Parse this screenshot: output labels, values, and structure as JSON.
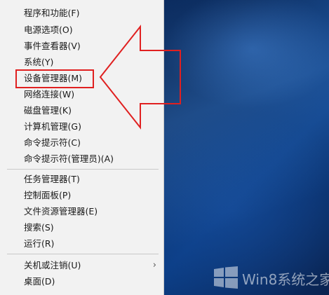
{
  "menu": {
    "items": [
      {
        "label": "程序和功能(F)"
      },
      {
        "label": "电源选项(O)"
      },
      {
        "label": "事件查看器(V)"
      },
      {
        "label": "系统(Y)"
      },
      {
        "label": "设备管理器(M)"
      },
      {
        "label": "网络连接(W)"
      },
      {
        "label": "磁盘管理(K)"
      },
      {
        "label": "计算机管理(G)"
      },
      {
        "label": "命令提示符(C)"
      },
      {
        "label": "命令提示符(管理员)(A)"
      },
      {
        "label": "任务管理器(T)"
      },
      {
        "label": "控制面板(P)"
      },
      {
        "label": "文件资源管理器(E)"
      },
      {
        "label": "搜索(S)"
      },
      {
        "label": "运行(R)"
      },
      {
        "label": "关机或注销(U)"
      },
      {
        "label": "桌面(D)"
      }
    ],
    "submenu_chevron": "›"
  },
  "annotation": {
    "highlight_color": "#e02020",
    "arrow_color": "#e02020",
    "highlighted_item": "设备管理器(M)"
  },
  "watermark": {
    "text": "Win8系统之家",
    "icon": "windows-logo-icon"
  }
}
